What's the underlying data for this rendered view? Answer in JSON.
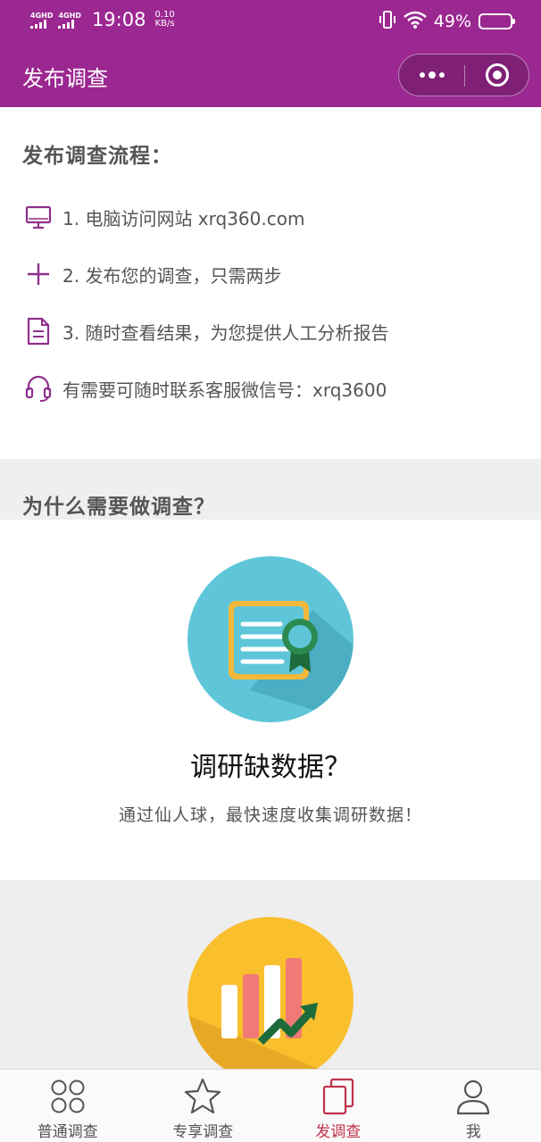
{
  "status_bar": {
    "signal_1": "4GHD",
    "signal_2": "4GHD",
    "time": "19:08",
    "speed_value": "0.10",
    "speed_unit": "KB/s",
    "battery_percent": "49%",
    "battery_level": 0.49
  },
  "nav": {
    "title": "发布调查",
    "more_icon": "more-dots-icon",
    "close_icon": "close-circle-icon"
  },
  "process": {
    "heading": "发布调查流程：",
    "steps": [
      {
        "icon": "monitor-icon",
        "text": "1. 电脑访问网站 xrq360.com"
      },
      {
        "icon": "plus-icon",
        "text": "2. 发布您的调查，只需两步"
      },
      {
        "icon": "document-icon",
        "text": "3. 随时查看结果，为您提供人工分析报告"
      },
      {
        "icon": "headset-icon",
        "text": "有需要可随时联系客服微信号：xrq3600"
      }
    ]
  },
  "why": {
    "heading": "为什么需要做调查？",
    "cards": [
      {
        "icon": "certificate-icon",
        "title": "调研缺数据？",
        "desc": "通过仙人球，最快速度收集调研数据！"
      },
      {
        "icon": "growth-chart-icon"
      }
    ]
  },
  "tabs": [
    {
      "icon": "grid-circles-icon",
      "label": "普通调查",
      "active": false
    },
    {
      "icon": "star-icon",
      "label": "专享调查",
      "active": false
    },
    {
      "icon": "copy-pages-icon",
      "label": "发调查",
      "active": true
    },
    {
      "icon": "user-icon",
      "label": "我",
      "active": false
    }
  ],
  "colors": {
    "brand": "#9b2790",
    "icon_purple": "#8e2f8c",
    "active_tab": "#c0334d",
    "teal": "#5fc6d9",
    "yellow": "#f9bf2d"
  }
}
